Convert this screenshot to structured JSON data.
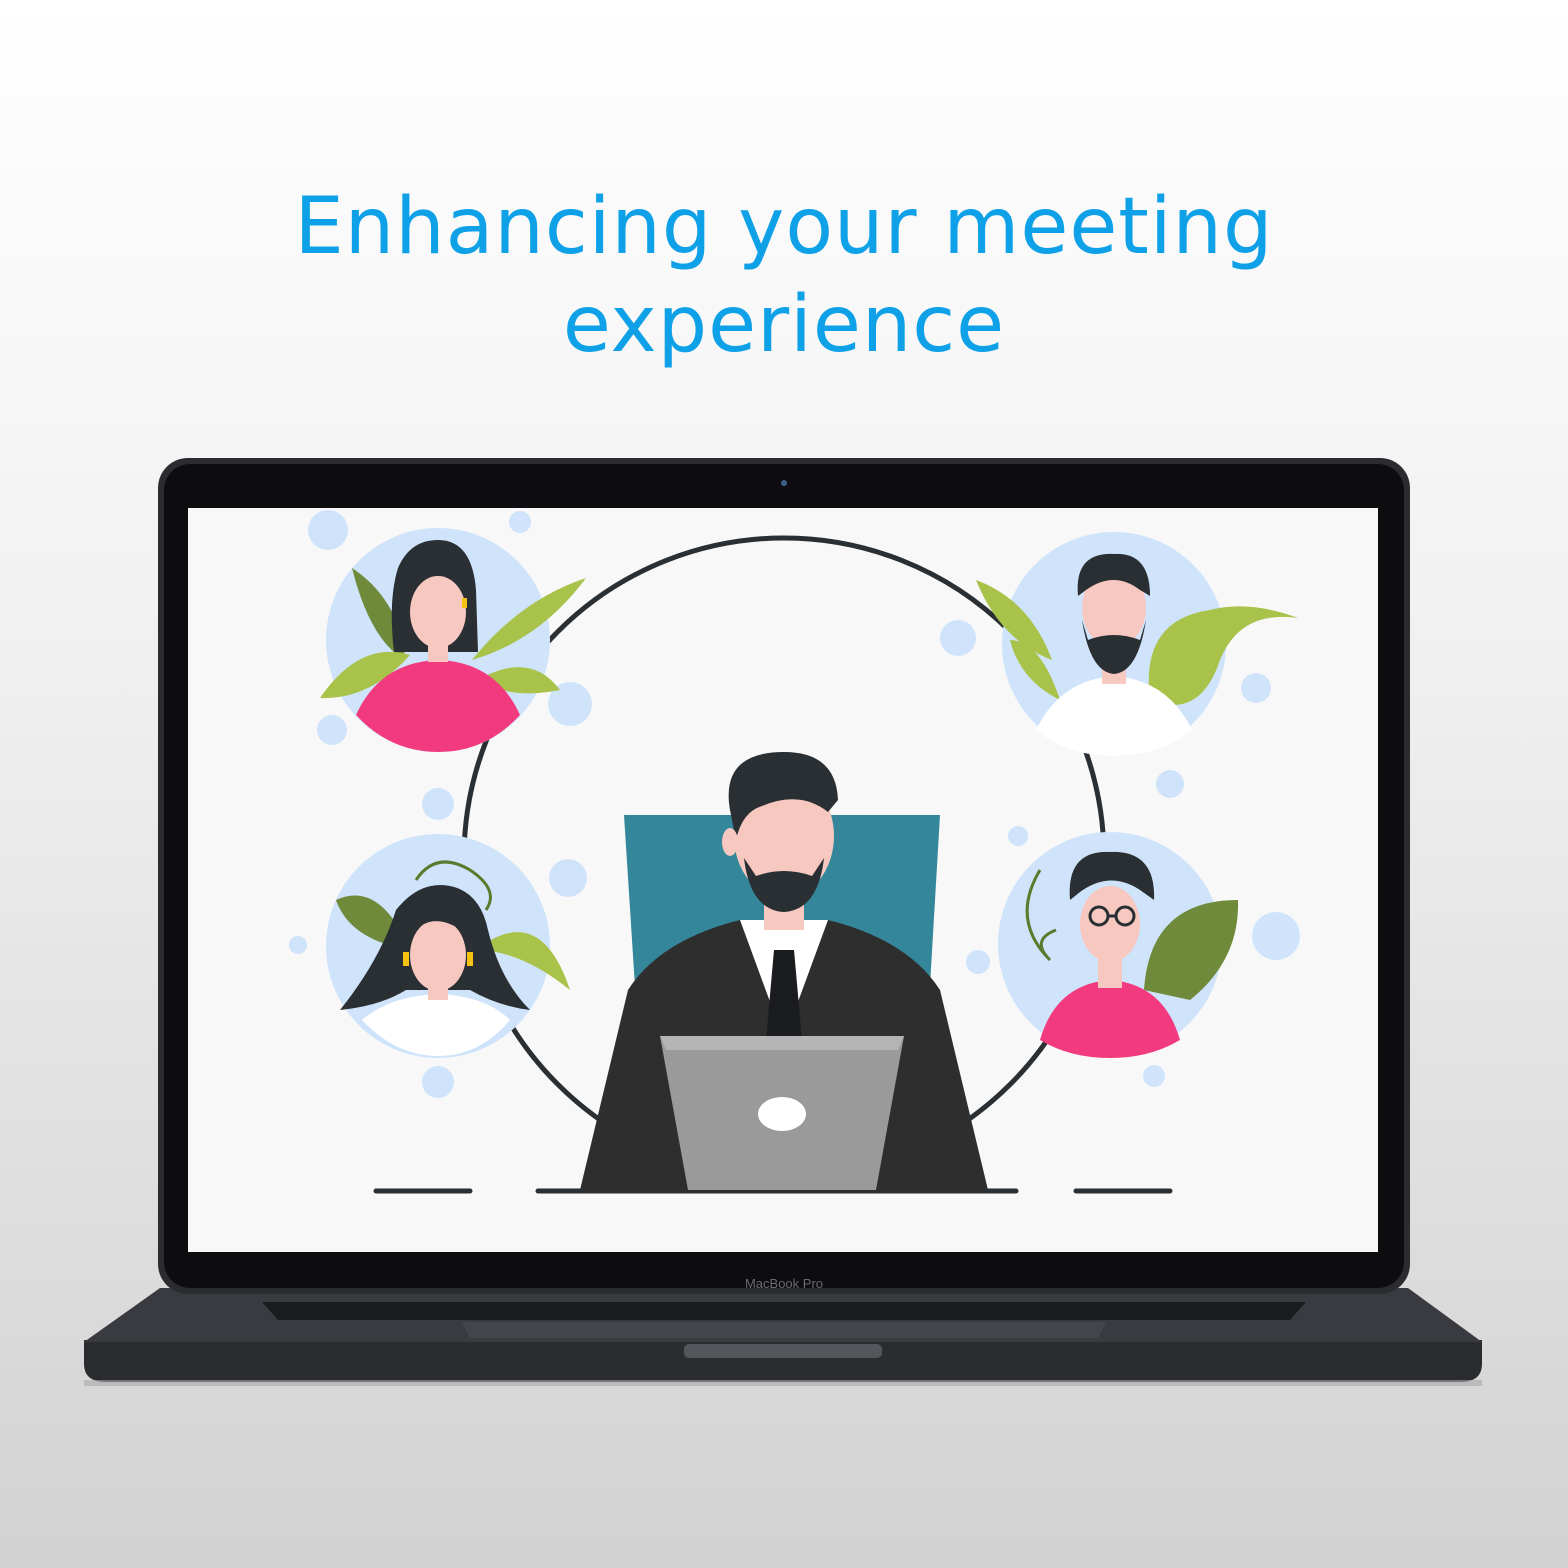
{
  "headline": {
    "line1": "Enhancing your meeting",
    "line2": "experience"
  },
  "laptop": {
    "brand_label": "MacBook Pro"
  },
  "colors": {
    "headline": "#0ea1e8",
    "laptop_body": "#2b2c30",
    "screen_bg": "#f8f8f8",
    "bubble": "#cfe4fb",
    "pink_shirt": "#f23b7f",
    "leaf_dark": "#6f8a3a",
    "leaf_light": "#a9c24a",
    "chair": "#34879b",
    "suit": "#2e2e2e",
    "hair": "#2a2f33",
    "skin": "#f6c8c0"
  }
}
